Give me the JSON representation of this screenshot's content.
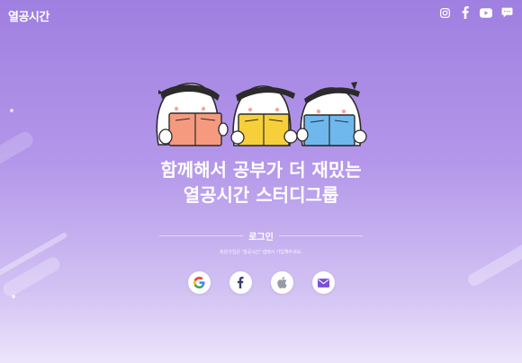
{
  "header": {
    "logo": "열공시간",
    "social": [
      {
        "icon": "instagram-icon"
      },
      {
        "icon": "facebook-icon"
      },
      {
        "icon": "youtube-icon"
      },
      {
        "icon": "chat-icon"
      }
    ]
  },
  "main": {
    "headline_line1": "함께해서 공부가 더 재밌는",
    "headline_line2": "열공시간 스터디그룹",
    "login_label": "로그인",
    "subtext": "회원가입은 '열공시간' 앱에서 가입해주세요.",
    "login_buttons": [
      {
        "icon": "google-icon"
      },
      {
        "icon": "facebook-icon"
      },
      {
        "icon": "apple-icon"
      },
      {
        "icon": "email-icon"
      }
    ]
  },
  "colors": {
    "gradient_top": "#9f7fe0",
    "gradient_bottom": "#ece5fb",
    "book_orange": "#f59a7e",
    "book_yellow": "#f7cf3a",
    "book_blue": "#6fb8ee",
    "email_purple": "#7b4fd6"
  }
}
